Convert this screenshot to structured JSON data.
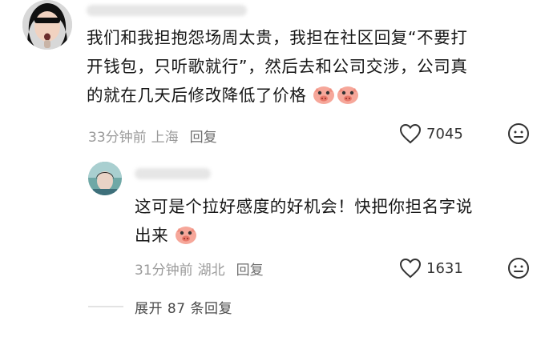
{
  "comment1": {
    "lines": [
      "我们和我担抱怨场周太贵，我担在社区回复“不要打",
      "开钱包，只听歌就行”，然后去和公司交涉，公司真",
      "的就在几天后修改降低了价格"
    ],
    "time": "33分钟前",
    "location": "上海",
    "reply_label": "回复",
    "likes": "7045",
    "emojis": [
      "pig-face-emoji",
      "pig-face-emoji"
    ]
  },
  "comment2": {
    "lines": [
      "这可是个拉好感度的好机会！快把你担名字说",
      "出来"
    ],
    "time": "31分钟前",
    "location": "湖北",
    "reply_label": "回复",
    "likes": "1631",
    "emojis": [
      "pig-face-emoji"
    ]
  },
  "expand_label": "展开 87 条回复",
  "icons": {
    "like": "heart-outline-icon",
    "dislike": "meh-face-icon"
  }
}
